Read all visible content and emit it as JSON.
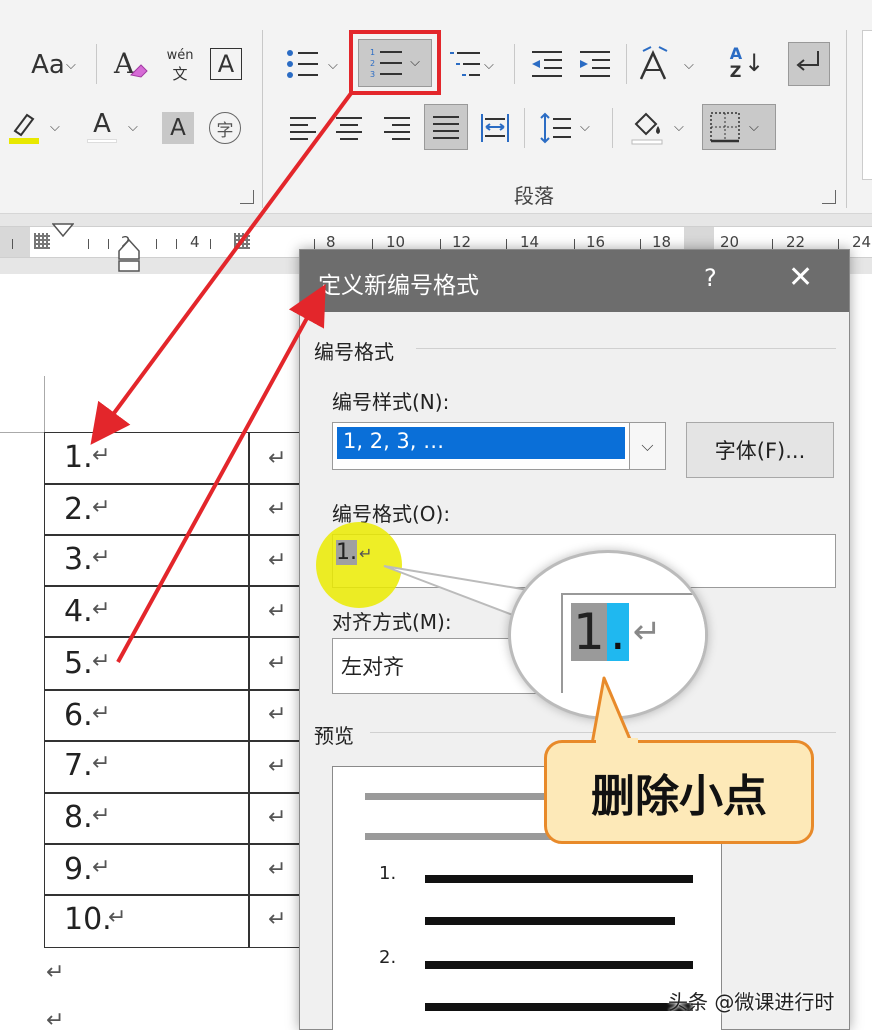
{
  "ribbon": {
    "font_case_label": "Aa",
    "phonetic_top": "wén",
    "phonetic_bottom": "文",
    "border_char_label": "A",
    "font_color_label": "A",
    "char_shading_label": "A",
    "enclose_char_label": "字",
    "sort_top": "A",
    "sort_bottom": "Z",
    "group_label": "段落",
    "dropdown_glyph": "⌵",
    "highlight_color": "#e8e800",
    "accent_red": "#e3262b"
  },
  "ruler": {
    "numbers": [
      "2",
      "4",
      "8",
      "10",
      "12",
      "14",
      "16",
      "18",
      "20",
      "22",
      "24"
    ]
  },
  "document": {
    "rows": [
      "1.",
      "2.",
      "3.",
      "4.",
      "5.",
      "6.",
      "7.",
      "8.",
      "9.",
      "10."
    ],
    "return_mark": "↵"
  },
  "dialog": {
    "title": "定义新编号格式",
    "help": "?",
    "close": "✕",
    "section_format": "编号格式",
    "style_label": "编号样式(N):",
    "style_value": "1, 2, 3, …",
    "font_button": "字体(F)...",
    "format_label": "编号格式(O):",
    "format_value": "1.",
    "align_label": "对齐方式(M):",
    "align_value": "左对齐",
    "preview_label": "预览",
    "preview_items": [
      "1.",
      "2."
    ]
  },
  "annotations": {
    "zoom_text": "1.",
    "callout": "删除小点",
    "watermark": "头条 @微课进行时"
  }
}
